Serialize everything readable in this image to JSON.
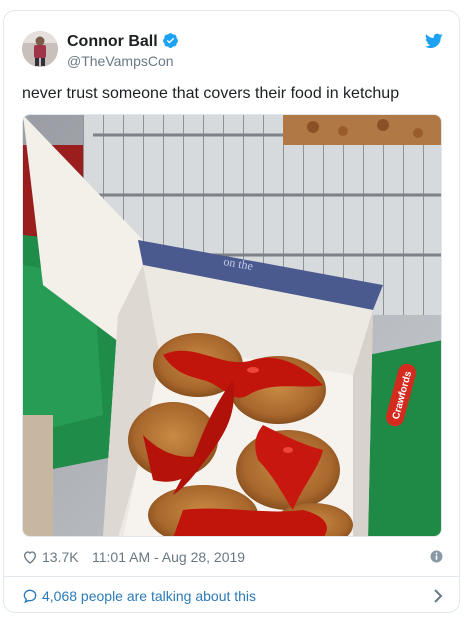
{
  "tweet": {
    "author": {
      "display_name": "Connor Ball",
      "handle": "@TheVampsCon",
      "verified": true,
      "avatar_icon": "user-avatar"
    },
    "text": "never trust someone that covers their food in ketchup",
    "media": {
      "description_icon": "photo-chicken-nuggets-with-ketchup",
      "box_lid_text": "on the",
      "packet_text": "Crawfords"
    },
    "likes": "13.7K",
    "timestamp": "11:01 AM - Aug 28, 2019",
    "conversation": "4,068 people are talking about this"
  },
  "colors": {
    "brand_blue": "#1da1f2",
    "link_blue": "#2b7bb9",
    "text": "#1c2022",
    "muted": "#697882",
    "border": "#e1e8ed"
  },
  "icons": {
    "verified": "verified-badge-icon",
    "platform": "twitter-bird-icon",
    "like": "heart-icon",
    "info": "info-icon",
    "reply": "speech-bubble-icon",
    "more": "chevron-right-icon"
  }
}
